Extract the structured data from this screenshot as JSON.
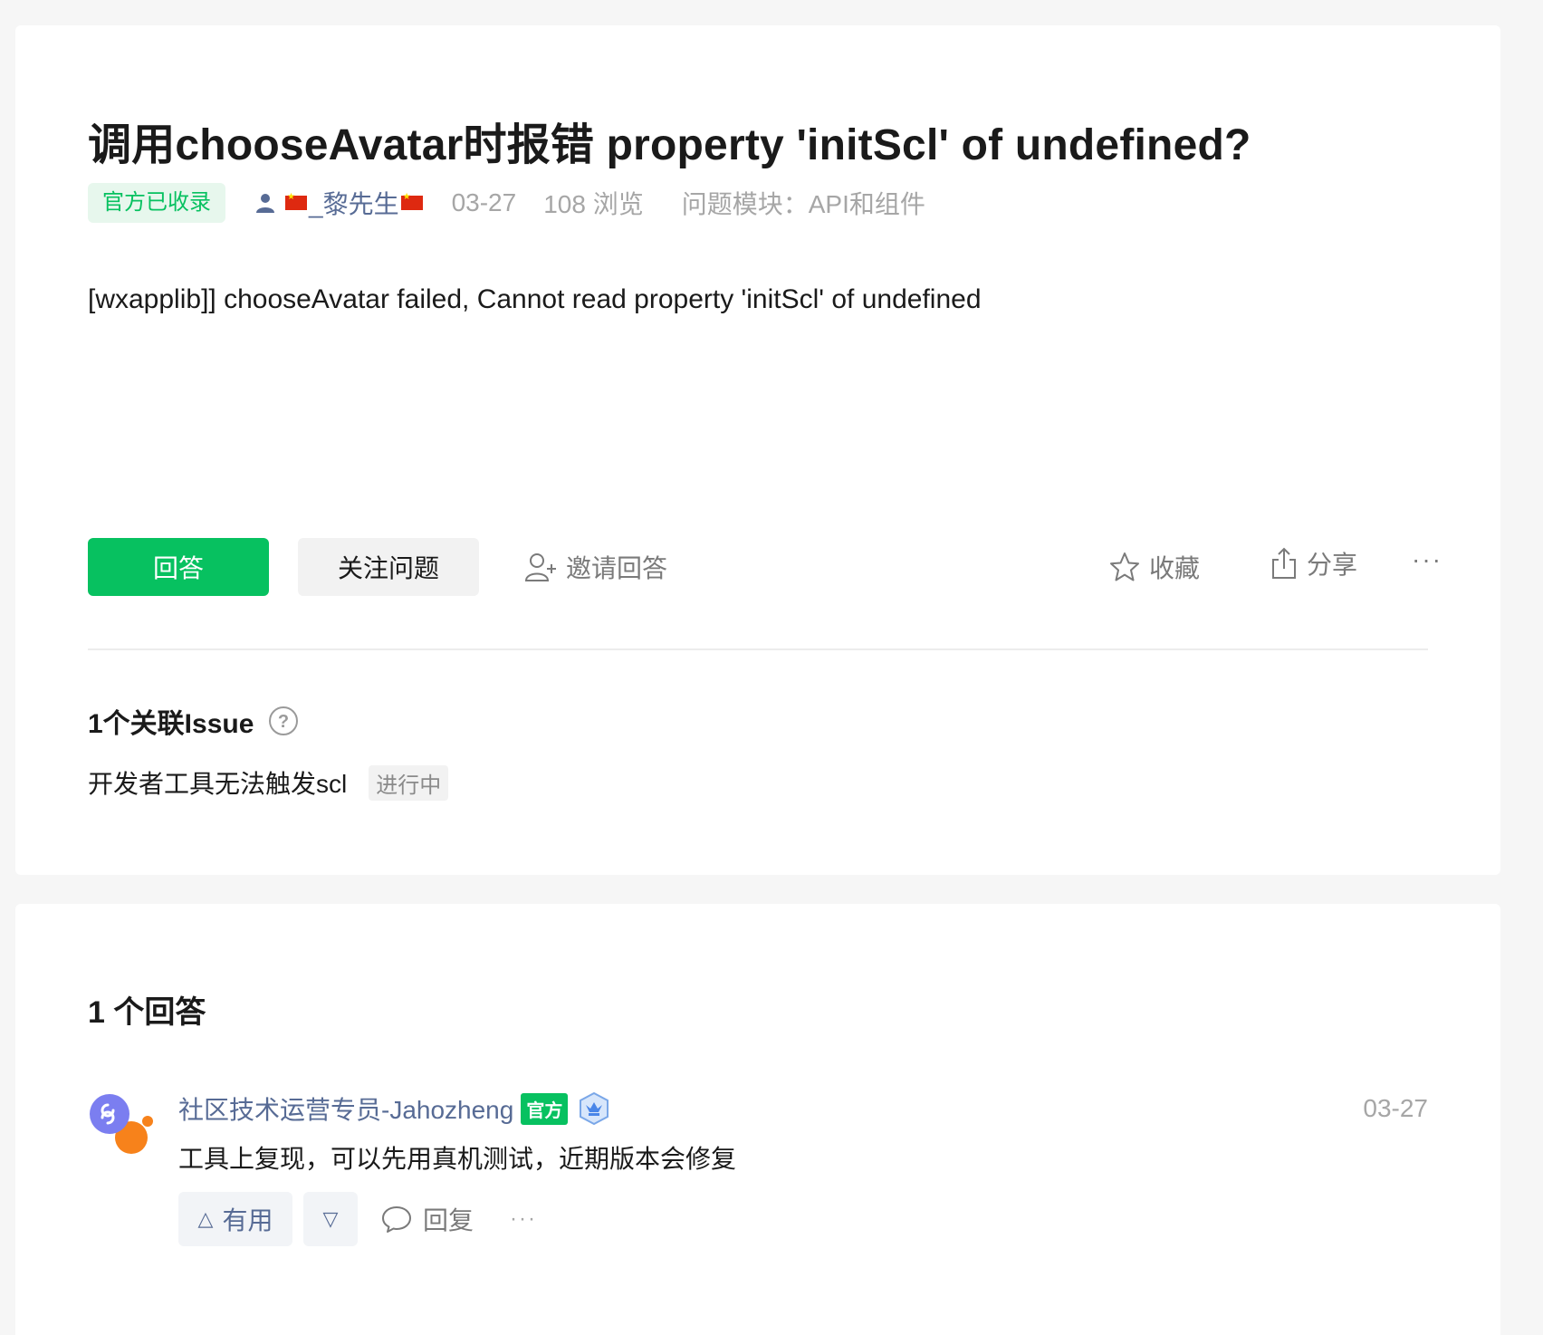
{
  "question": {
    "title": "调用chooseAvatar时报错 property 'initScl' of undefined?",
    "tag": "官方已收录",
    "author": "_黎先生",
    "date": "03-27",
    "views": "108 浏览",
    "module_label": "问题模块：",
    "module_value": "API和组件",
    "body": "[wxapplib]] chooseAvatar failed, Cannot read property 'initScl' of undefined",
    "actions": {
      "answer": "回答",
      "follow": "关注问题",
      "invite": "邀请回答",
      "collect": "收藏",
      "share": "分享",
      "more": "···"
    }
  },
  "issues": {
    "heading": "1个关联Issue",
    "items": [
      {
        "title": "开发者工具无法触发scl",
        "status": "进行中"
      }
    ]
  },
  "answers": {
    "heading": "1 个回答",
    "items": [
      {
        "author": "社区技术运营专员-Jahozheng",
        "badge": "官方",
        "date": "03-27",
        "text": "工具上复现，可以先用真机测试，近期版本会修复",
        "useful": "有用",
        "reply": "回复",
        "more": "···"
      }
    ]
  },
  "colors": {
    "brand_green": "#07c160",
    "link_blue": "#576b95",
    "muted_gray": "#a6a6a6"
  },
  "icons": [
    "person-icon",
    "flag-icon",
    "add-user-icon",
    "star-icon",
    "share-icon",
    "help-icon",
    "verified-icon",
    "comment-icon"
  ]
}
